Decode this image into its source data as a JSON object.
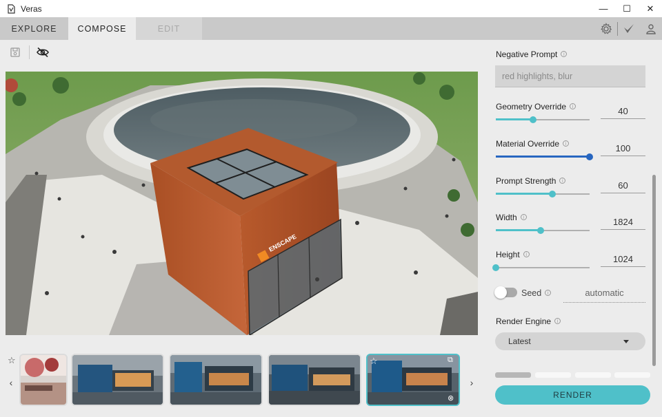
{
  "window": {
    "title": "Veras",
    "minimize": "—",
    "maximize": "☐",
    "close": "✕"
  },
  "tabs": [
    {
      "label": "EXPLORE"
    },
    {
      "label": "COMPOSE"
    },
    {
      "label": "EDIT"
    }
  ],
  "header_icons": [
    "gear-icon",
    "checkmark-icon",
    "user-icon"
  ],
  "toolbar": {
    "icons": [
      "save-icon",
      "visibility-off-icon"
    ]
  },
  "main_image": {
    "description_icon": "rendered-image",
    "sign_text": "ENSCAPE"
  },
  "thumbnails": {
    "count": 5,
    "selected_index": 4
  },
  "panel": {
    "negative_prompt": {
      "label": "Negative Prompt",
      "value": "red highlights, blur"
    },
    "sliders": [
      {
        "label": "Geometry Override",
        "value": "40",
        "fraction": 0.4,
        "style": "light"
      },
      {
        "label": "Material Override",
        "value": "100",
        "fraction": 1.0,
        "style": "dark"
      },
      {
        "label": "Prompt Strength",
        "value": "60",
        "fraction": 0.6,
        "style": "light"
      },
      {
        "label": "Width",
        "value": "1824",
        "fraction": 0.48,
        "style": "light"
      },
      {
        "label": "Height",
        "value": "1024",
        "fraction": 0.0,
        "style": "light"
      }
    ],
    "seed": {
      "label": "Seed",
      "value": "automatic",
      "enabled": false
    },
    "render_engine": {
      "label": "Render Engine",
      "value": "Latest"
    },
    "progress": {
      "completed_segments": 1,
      "total_segments": 4
    },
    "render_button": "RENDER"
  },
  "colors": {
    "accent": "#4fc0c9",
    "accent_dark": "#2766c0",
    "panel": "#ececec",
    "tabbar": "#c9c9c9"
  }
}
